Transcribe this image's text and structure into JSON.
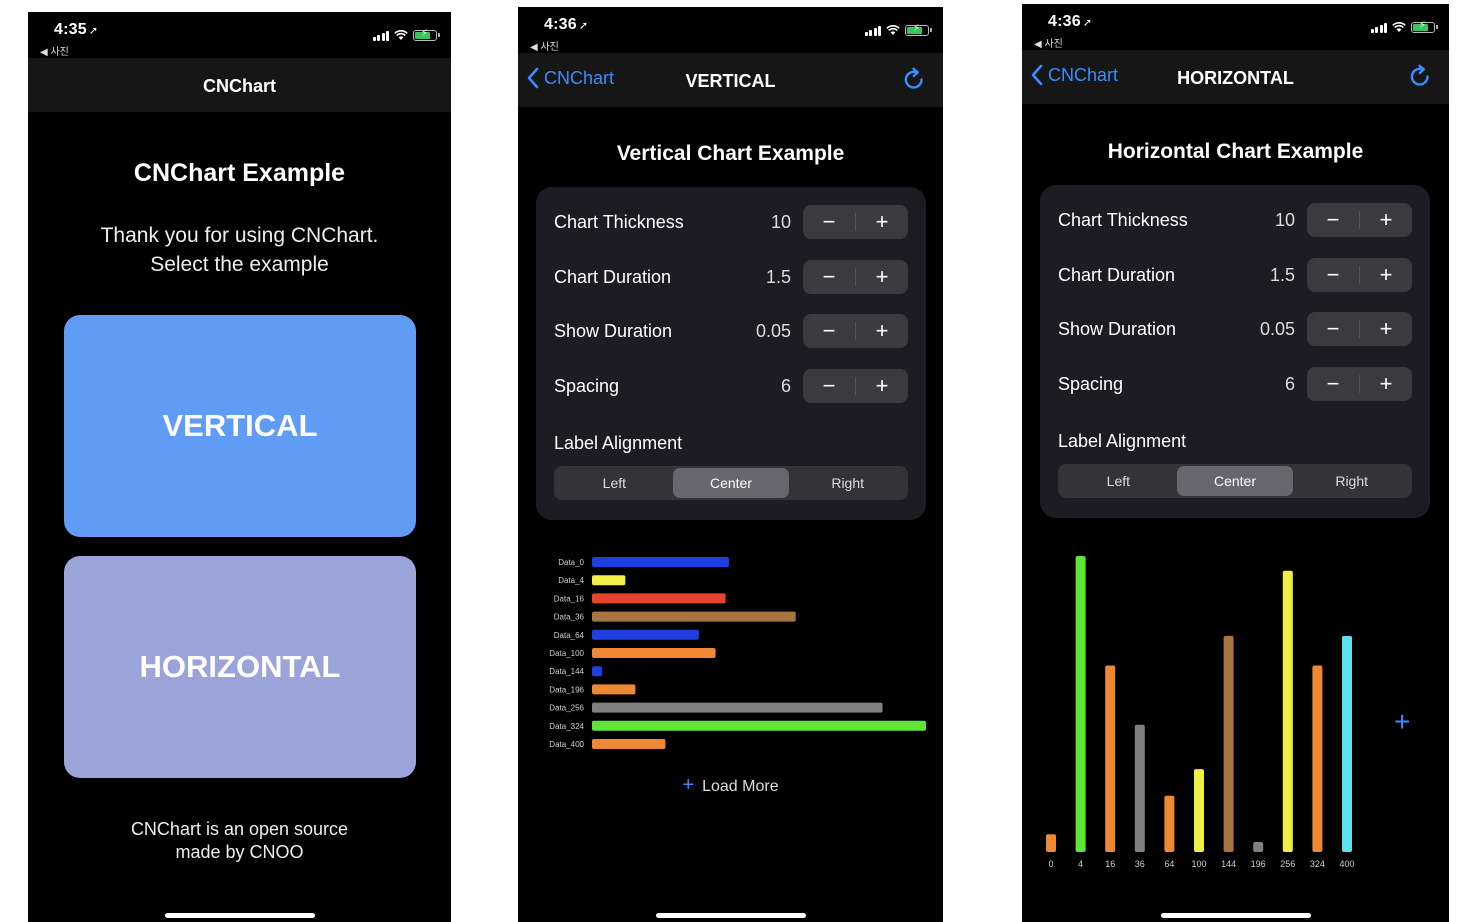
{
  "status1": {
    "time": "4:35",
    "back_app": "◀ 사진"
  },
  "status2": {
    "time": "4:36",
    "back_app": "◀ 사진"
  },
  "status3": {
    "time": "4:36",
    "back_app": "◀ 사진"
  },
  "screen1": {
    "nav_title": "CNChart",
    "title": "CNChart Example",
    "desc_line1": "Thank you for using CNChart.",
    "desc_line2": "Select the example",
    "vertical_button": "VERTICAL",
    "horizontal_button": "HORIZONTAL",
    "footer_line1": "CNChart is an open source",
    "footer_line2": "made by CNOO",
    "colors": {
      "vertical": "#609bf6",
      "horizontal": "#9aa4d8"
    }
  },
  "screen2": {
    "nav_back": "CNChart",
    "nav_title": "VERTICAL",
    "page_title": "Vertical Chart Example",
    "settings": [
      {
        "label": "Chart Thickness",
        "value": "10"
      },
      {
        "label": "Chart Duration",
        "value": "1.5"
      },
      {
        "label": "Show Duration",
        "value": "0.05"
      },
      {
        "label": "Spacing",
        "value": "6"
      }
    ],
    "stepper_minus": "−",
    "stepper_plus": "+",
    "label_alignment": "Label Alignment",
    "alignment_options": [
      "Left",
      "Center",
      "Right"
    ],
    "alignment_selected": "Center",
    "load_more": "Load More",
    "load_more_icon": "+"
  },
  "screen3": {
    "nav_back": "CNChart",
    "nav_title": "HORIZONTAL",
    "page_title": "Horizontal Chart Example",
    "settings": [
      {
        "label": "Chart Thickness",
        "value": "10"
      },
      {
        "label": "Chart Duration",
        "value": "1.5"
      },
      {
        "label": "Show Duration",
        "value": "0.05"
      },
      {
        "label": "Spacing",
        "value": "6"
      }
    ],
    "stepper_minus": "−",
    "stepper_plus": "+",
    "label_alignment": "Label Alignment",
    "alignment_options": [
      "Left",
      "Center",
      "Right"
    ],
    "alignment_selected": "Center",
    "add_icon": "+"
  },
  "chart_data": [
    {
      "type": "bar",
      "orientation": "horizontal",
      "categories": [
        "Data_0",
        "Data_4",
        "Data_16",
        "Data_36",
        "Data_64",
        "Data_100",
        "Data_144",
        "Data_196",
        "Data_256",
        "Data_324",
        "Data_400"
      ],
      "values": [
        41,
        10,
        40,
        61,
        32,
        37,
        2,
        13,
        87,
        100,
        22
      ],
      "colors": [
        "#1f3fe0",
        "#f2ee45",
        "#e8442a",
        "#a87542",
        "#1f3fe0",
        "#ee8833",
        "#1f3fe0",
        "#ee8833",
        "#808080",
        "#5de53a",
        "#ee8833"
      ],
      "xlim": [
        0,
        100
      ]
    },
    {
      "type": "bar",
      "orientation": "vertical",
      "categories": [
        "0",
        "4",
        "16",
        "36",
        "64",
        "100",
        "144",
        "196",
        "256",
        "324",
        "400"
      ],
      "values": [
        6,
        100,
        63,
        43,
        19,
        28,
        73,
        2,
        95,
        63,
        73
      ],
      "colors": [
        "#ee8833",
        "#5de53a",
        "#ee8833",
        "#808080",
        "#ee8833",
        "#f2ee45",
        "#a87542",
        "#808080",
        "#f2ee45",
        "#ee8833",
        "#5ce0ee"
      ],
      "ylim": [
        0,
        100
      ]
    }
  ]
}
